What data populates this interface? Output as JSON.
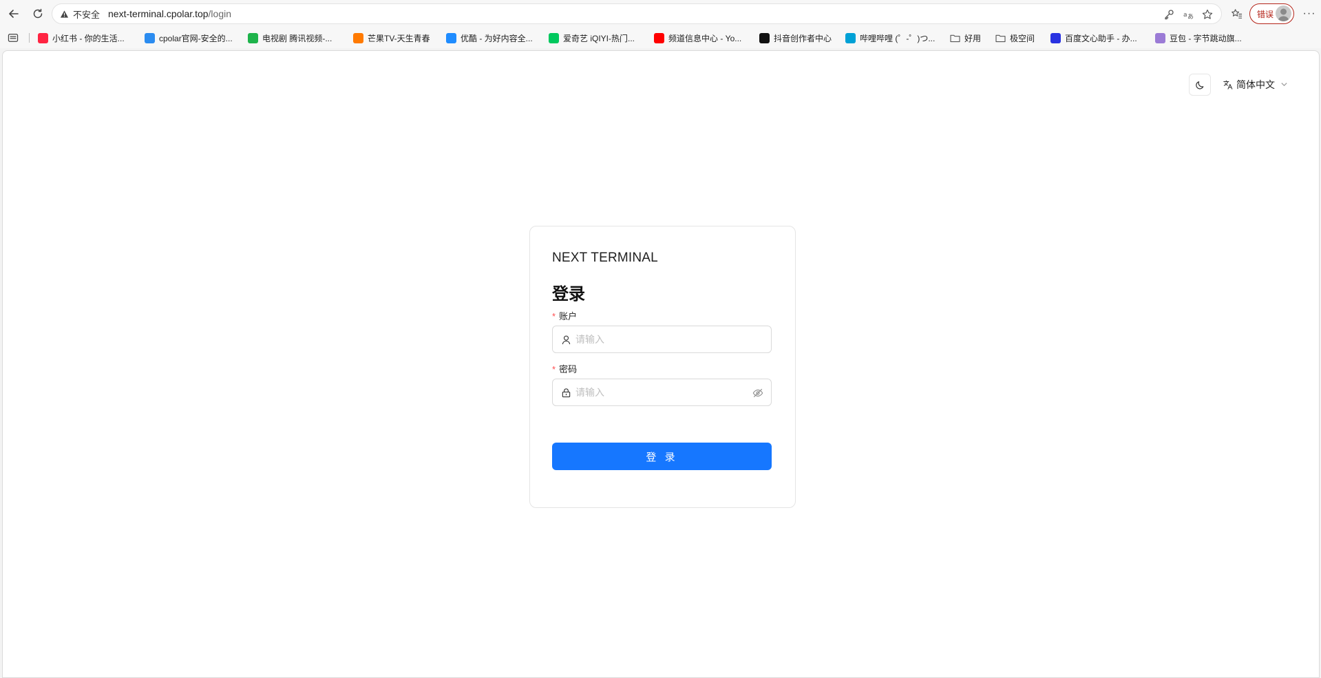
{
  "browser": {
    "insecure_label": "不安全",
    "url_host": "next-terminal.cpolar.top",
    "url_path": "/login",
    "error_badge": "错误"
  },
  "bookmarks": [
    {
      "label": "小红书 - 你的生活...",
      "icon": "xiaohongshu-icon",
      "color": "#ff2442"
    },
    {
      "label": "cpolar官网-安全的...",
      "icon": "cpolar-icon",
      "color": "#2b8cf0"
    },
    {
      "label": "电视剧 腾讯视频-...",
      "icon": "tencent-video-icon",
      "color": "#1eb34b"
    },
    {
      "label": "芒果TV-天生青春",
      "icon": "mgtv-icon",
      "color": "#ff7a00"
    },
    {
      "label": "优酷 - 为好内容全...",
      "icon": "youku-icon",
      "color": "#1f8cff"
    },
    {
      "label": "爱奇艺 iQIYI-热门...",
      "icon": "iqiyi-icon",
      "color": "#00c85e"
    },
    {
      "label": "频道信息中心 - Yo...",
      "icon": "youtube-icon",
      "color": "#ff0000"
    },
    {
      "label": "抖音创作者中心",
      "icon": "douyin-icon",
      "color": "#111111"
    },
    {
      "label": "哔哩哔哩 (゜-゜)つ...",
      "icon": "bilibili-icon",
      "color": "#00a1d6"
    },
    {
      "label": "好用",
      "icon": "folder-icon",
      "color": "#555555"
    },
    {
      "label": "极空间",
      "icon": "folder-icon",
      "color": "#555555"
    },
    {
      "label": "百度文心助手 - 办...",
      "icon": "baidu-icon",
      "color": "#2932e1"
    },
    {
      "label": "豆包 - 字节跳动旗...",
      "icon": "doubao-icon",
      "color": "#9b7bd6"
    }
  ],
  "header": {
    "language": "简体中文"
  },
  "login": {
    "brand": "NEXT TERMINAL",
    "title": "登录",
    "account_label": "账户",
    "account_placeholder": "请输入",
    "password_label": "密码",
    "password_placeholder": "请输入",
    "submit_label": "登 录",
    "required_mark": "*"
  },
  "colors": {
    "primary": "#1677ff",
    "required": "#ff4d4f",
    "error": "#b42318"
  }
}
